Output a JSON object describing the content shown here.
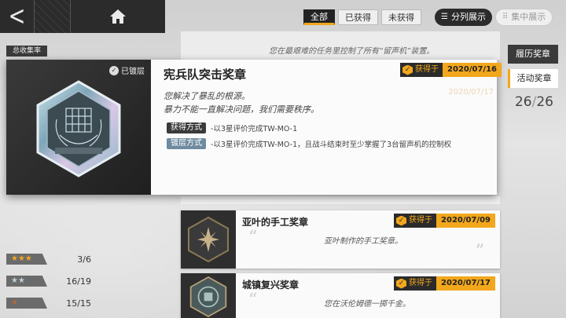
{
  "nav": {
    "back_glyph": "<",
    "home_icon": "home-icon"
  },
  "filters": {
    "all": "全部",
    "obtained": "已获得",
    "not_obtained": "未获得"
  },
  "view_modes": {
    "list": "分列展示",
    "grid": "集中展示"
  },
  "sidebar": {
    "history_tab": "履历奖章",
    "event_tab": "活动奖章",
    "count_current": "26",
    "count_sep": "/",
    "count_total": "26"
  },
  "summary": {
    "label": "总收集率",
    "rows": [
      {
        "stars": "★★★",
        "tier": "gold",
        "count": "3/6"
      },
      {
        "stars": "★★",
        "tier": "silver",
        "count": "16/19"
      },
      {
        "stars": "★",
        "tier": "bronze",
        "count": "15/15"
      }
    ]
  },
  "background_text": {
    "top_desc": "您在最艰难的任务里控制了所有“留声机”装置。",
    "behind_date": "2020/07/17"
  },
  "detail": {
    "plated_label": "已镀层",
    "title": "宪兵队突击奖章",
    "desc_line1": "您解决了暴乱的根源。",
    "desc_line2": "暴力不能一直解决问题，我们需要秩序。",
    "obtain_method_label": "获得方式",
    "obtain_method_text": "-以3星评价完成TW-MO-1",
    "plating_method_label": "镀层方式",
    "plating_method_text": "-以3星评价完成TW-MO-1，且战斗结束时至少掌握了3台留声机的控制权",
    "obtained_label": "获得于",
    "obtained_date": "2020/07/16"
  },
  "cards": [
    {
      "title": "亚叶的手工奖章",
      "desc": "亚叶制作的手工奖章。",
      "obtained_label": "获得于",
      "date": "2020/07/09"
    },
    {
      "title": "城镇复兴奖章",
      "desc": "您在沃伦姆德一掷千金。",
      "obtained_label": "获得于",
      "date": "2020/07/17"
    }
  ],
  "colors": {
    "accent": "#f2a71c",
    "dark": "#2b2b2b",
    "plating_blue": "#6e8ba0"
  }
}
